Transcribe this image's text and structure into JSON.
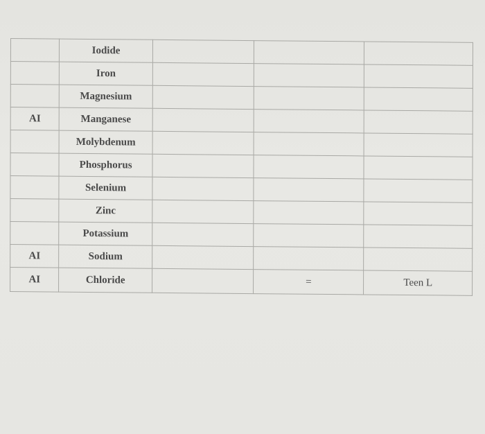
{
  "table": {
    "rows": [
      {
        "col1": "",
        "nutrient": "Iodide",
        "col3": "",
        "col4": "",
        "col5": ""
      },
      {
        "col1": "",
        "nutrient": "Iron",
        "col3": "",
        "col4": "",
        "col5": ""
      },
      {
        "col1": "",
        "nutrient": "Magnesium",
        "col3": "",
        "col4": "",
        "col5": ""
      },
      {
        "col1": "AI",
        "nutrient": "Manganese",
        "col3": "",
        "col4": "",
        "col5": ""
      },
      {
        "col1": "",
        "nutrient": "Molybdenum",
        "col3": "",
        "col4": "",
        "col5": ""
      },
      {
        "col1": "",
        "nutrient": "Phosphorus",
        "col3": "",
        "col4": "",
        "col5": ""
      },
      {
        "col1": "",
        "nutrient": "Selenium",
        "col3": "",
        "col4": "",
        "col5": ""
      },
      {
        "col1": "",
        "nutrient": "Zinc",
        "col3": "",
        "col4": "",
        "col5": ""
      },
      {
        "col1": "",
        "nutrient": "Potassium",
        "col3": "",
        "col4": "",
        "col5": ""
      },
      {
        "col1": "AI",
        "nutrient": "Sodium",
        "col3": "",
        "col4": "",
        "col5": ""
      },
      {
        "col1": "AI",
        "nutrient": "Chloride",
        "col3": "",
        "col4": "=",
        "col5": "Teen L"
      }
    ]
  }
}
